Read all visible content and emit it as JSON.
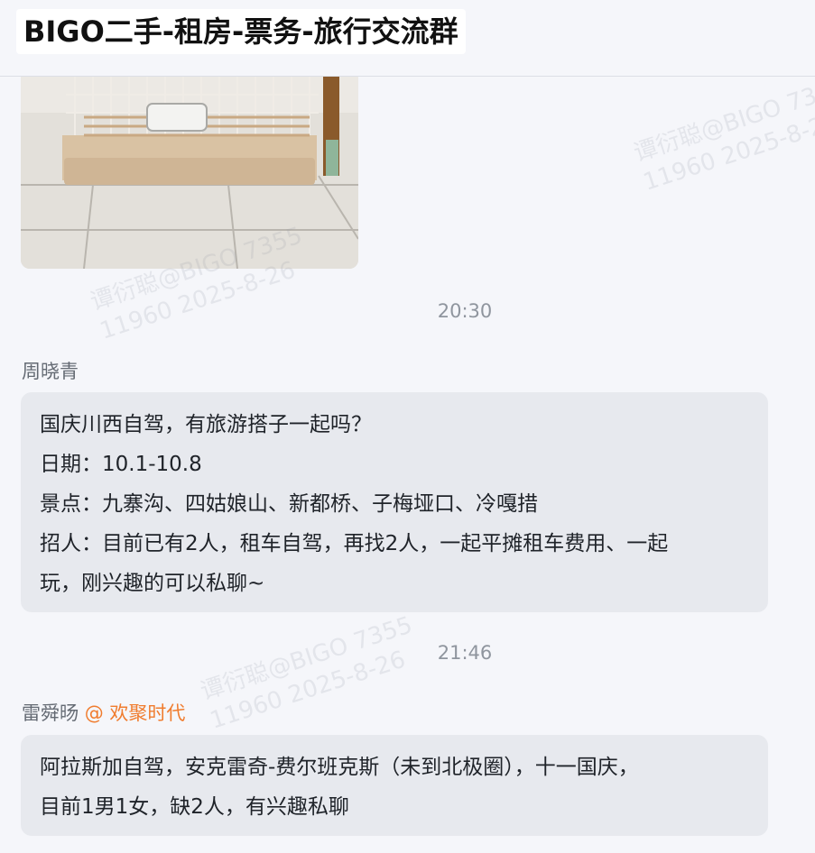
{
  "header": {
    "title": "BIGO二手-租房-票务-旅行交流群"
  },
  "photo": {
    "icon": "rabbit-cage-photo"
  },
  "messages": [
    {
      "time": "20:30"
    },
    {
      "sender": "周晓青",
      "lines": [
        "国庆川西自驾，有旅游搭子一起吗？",
        "日期：10.1-10.8",
        "景点：九寨沟、四姑娘山、新都桥、子梅垭口、冷嘎措",
        "招人：目前已有2人，租车自驾，再找2人，一起平摊租车费用、一起",
        "玩，刚兴趣的可以私聊~"
      ]
    },
    {
      "time": "21:46"
    },
    {
      "sender": "雷舜旸",
      "mention": "@ 欢聚时代",
      "lines": [
        "阿拉斯加自驾，安克雷奇-费尔班克斯（未到北极圈），十一国庆，",
        "目前1男1女，缺2人，有兴趣私聊"
      ]
    }
  ],
  "watermark": {
    "line1": "谭衍聪@BIGO 7355",
    "line2": "11960 2025-8-26"
  },
  "colors": {
    "background": "#f5f6fa",
    "bubble": "#e7e9ee",
    "mention": "#f07c2e",
    "time": "#8f959e"
  }
}
